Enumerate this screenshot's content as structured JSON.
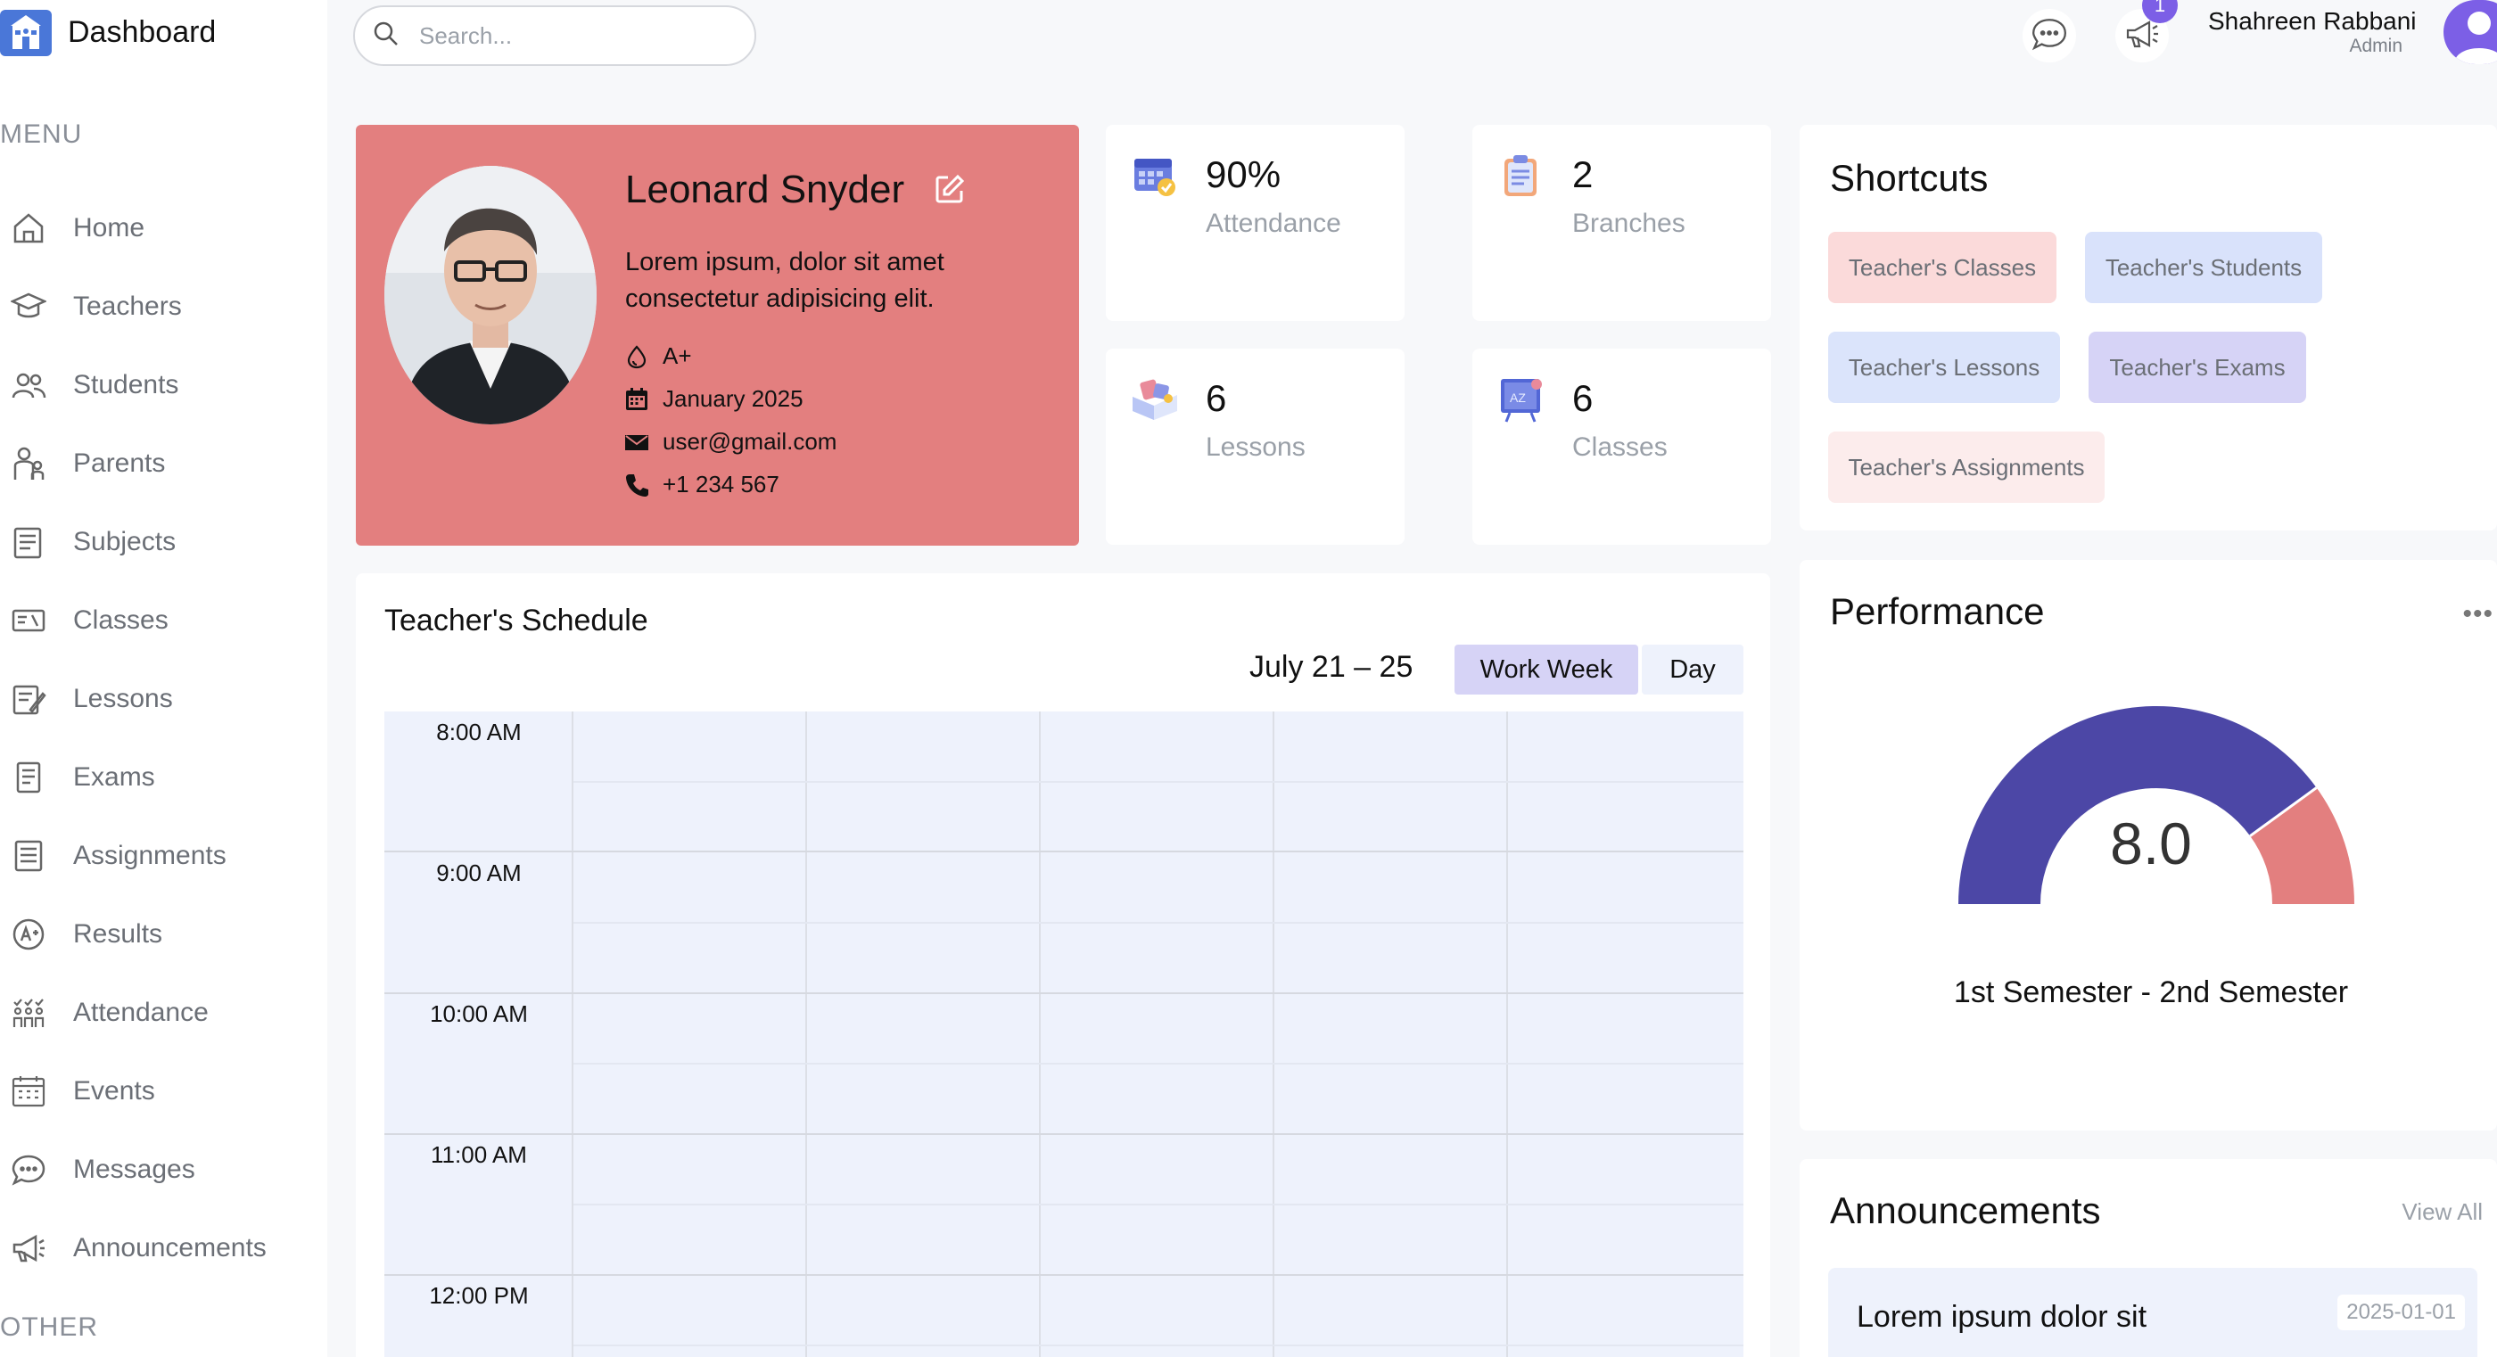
{
  "app": {
    "brand": "Dashboard"
  },
  "sidebar": {
    "menu_title": "MENU",
    "items": [
      {
        "label": "Home",
        "icon": "home-icon"
      },
      {
        "label": "Teachers",
        "icon": "teacher-icon"
      },
      {
        "label": "Students",
        "icon": "students-icon"
      },
      {
        "label": "Parents",
        "icon": "parents-icon"
      },
      {
        "label": "Subjects",
        "icon": "subjects-icon"
      },
      {
        "label": "Classes",
        "icon": "classes-icon"
      },
      {
        "label": "Lessons",
        "icon": "lessons-icon"
      },
      {
        "label": "Exams",
        "icon": "exams-icon"
      },
      {
        "label": "Assignments",
        "icon": "assignments-icon"
      },
      {
        "label": "Results",
        "icon": "results-icon"
      },
      {
        "label": "Attendance",
        "icon": "attendance-icon"
      },
      {
        "label": "Events",
        "icon": "events-icon"
      },
      {
        "label": "Messages",
        "icon": "messages-icon"
      },
      {
        "label": "Announcements",
        "icon": "announcements-icon"
      }
    ],
    "other_title": "OTHER"
  },
  "topbar": {
    "search_placeholder": "Search...",
    "notification_count": "1",
    "user_name": "Shahreen Rabbani",
    "user_role": "Admin"
  },
  "profile": {
    "name": "Leonard Snyder",
    "description": "Lorem ipsum, dolor sit amet consectetur adipisicing elit.",
    "blood_type": "A+",
    "date": "January 2025",
    "email": "user@gmail.com",
    "phone": "+1 234 567"
  },
  "stats": [
    {
      "value": "90%",
      "label": "Attendance",
      "icon": "attendance-calendar-icon"
    },
    {
      "value": "2",
      "label": "Branches",
      "icon": "branches-clipboard-icon"
    },
    {
      "value": "6",
      "label": "Lessons",
      "icon": "lessons-book-icon"
    },
    {
      "value": "6",
      "label": "Classes",
      "icon": "classes-board-icon"
    }
  ],
  "shortcuts": {
    "title": "Shortcuts",
    "items": [
      {
        "label": "Teacher's Classes",
        "color": "#fbdada"
      },
      {
        "label": "Teacher's Students",
        "color": "#d9e2fb"
      },
      {
        "label": "Teacher's Lessons",
        "color": "#dbe4fb"
      },
      {
        "label": "Teacher's Exams",
        "color": "#d6d3f6"
      },
      {
        "label": "Teacher's Assignments",
        "color": "#fcecec"
      }
    ]
  },
  "schedule": {
    "title": "Teacher's Schedule",
    "range": "July 21 – 25",
    "views": [
      "Work Week",
      "Day"
    ],
    "active_view": "Work Week",
    "times": [
      "8:00 AM",
      "9:00 AM",
      "10:00 AM",
      "11:00 AM",
      "12:00 PM"
    ]
  },
  "performance": {
    "title": "Performance",
    "more": "•••",
    "value": "8.0",
    "value_fraction": 0.8,
    "caption": "1st Semester - 2nd Semester",
    "colors": {
      "primary": "#4c47a6",
      "secondary": "#e37f7f"
    }
  },
  "announcements": {
    "title": "Announcements",
    "view_all": "View All",
    "items": [
      {
        "title": "Lorem ipsum dolor sit",
        "date": "2025-01-01"
      }
    ]
  },
  "colors": {
    "profile_bg": "#e37f7f",
    "accent": "#7c5fe6",
    "active_view_bg": "#d6d3f6",
    "grid_bg": "#eef2fc"
  }
}
